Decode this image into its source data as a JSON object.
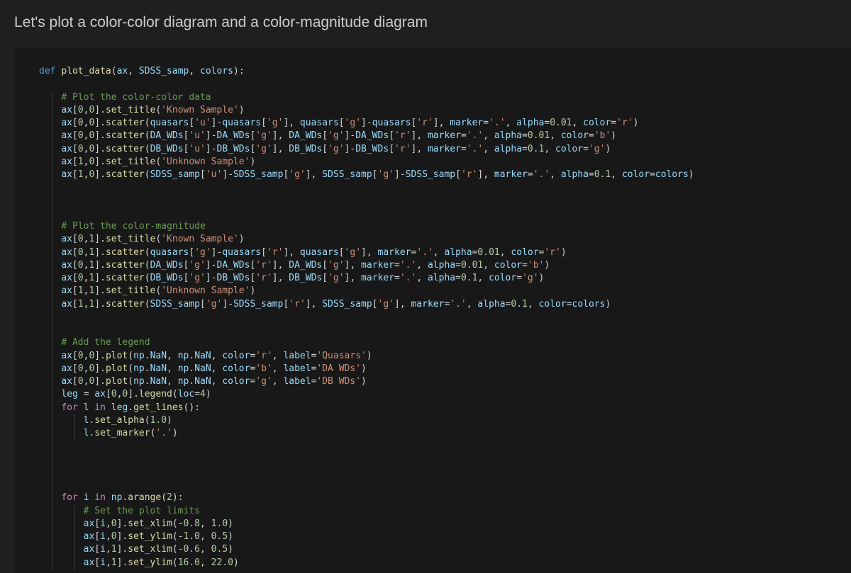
{
  "markdown_heading": "Let's plot a color-color diagram and a color-magnitude diagram",
  "colors": {
    "background": "#1f1f1f",
    "code_background": "#181818",
    "keyword": "#c586c0",
    "def_keyword": "#569cd6",
    "function": "#dcdcaa",
    "variable": "#9cdcfe",
    "string": "#ce9178",
    "number": "#b5cea8",
    "comment": "#6a9955",
    "operator": "#d4d4d4",
    "text": "#d4d4d4"
  },
  "code_lines": [
    "def plot_data(ax, SDSS_samp, colors):",
    "",
    "    # Plot the color-color data",
    "    ax[0,0].set_title('Known Sample')",
    "    ax[0,0].scatter(quasars['u']-quasars['g'], quasars['g']-quasars['r'], marker='.', alpha=0.01, color='r')",
    "    ax[0,0].scatter(DA_WDs['u']-DA_WDs['g'], DA_WDs['g']-DA_WDs['r'], marker='.', alpha=0.01, color='b')",
    "    ax[0,0].scatter(DB_WDs['u']-DB_WDs['g'], DB_WDs['g']-DB_WDs['r'], marker='.', alpha=0.1, color='g')",
    "    ax[1,0].set_title('Unknown Sample')",
    "    ax[1,0].scatter(SDSS_samp['u']-SDSS_samp['g'], SDSS_samp['g']-SDSS_samp['r'], marker='.', alpha=0.1, color=colors)",
    "",
    "",
    "",
    "    # Plot the color-magnitude",
    "    ax[0,1].set_title('Known Sample')",
    "    ax[0,1].scatter(quasars['g']-quasars['r'], quasars['g'], marker='.', alpha=0.01, color='r')",
    "    ax[0,1].scatter(DA_WDs['g']-DA_WDs['r'], DA_WDs['g'], marker='.', alpha=0.01, color='b')",
    "    ax[0,1].scatter(DB_WDs['g']-DB_WDs['r'], DB_WDs['g'], marker='.', alpha=0.1, color='g')",
    "    ax[1,1].set_title('Unknown Sample')",
    "    ax[1,1].scatter(SDSS_samp['g']-SDSS_samp['r'], SDSS_samp['g'], marker='.', alpha=0.1, color=colors)",
    "",
    "",
    "    # Add the legend",
    "    ax[0,0].plot(np.NaN, np.NaN, color='r', label='Quasars')",
    "    ax[0,0].plot(np.NaN, np.NaN, color='b', label='DA WDs')",
    "    ax[0,0].plot(np.NaN, np.NaN, color='g', label='DB WDs')",
    "    leg = ax[0,0].legend(loc=4)",
    "    for l in leg.get_lines():",
    "        l.set_alpha(1.0)",
    "        l.set_marker('.')",
    "",
    "",
    "",
    "",
    "    for i in np.arange(2):",
    "        # Set the plot limits",
    "        ax[i,0].set_xlim(-0.8, 1.0)",
    "        ax[i,0].set_ylim(-1.0, 0.5)",
    "        ax[i,1].set_xlim(-0.6, 0.5)",
    "        ax[i,1].set_ylim(16.0, 22.0)"
  ]
}
